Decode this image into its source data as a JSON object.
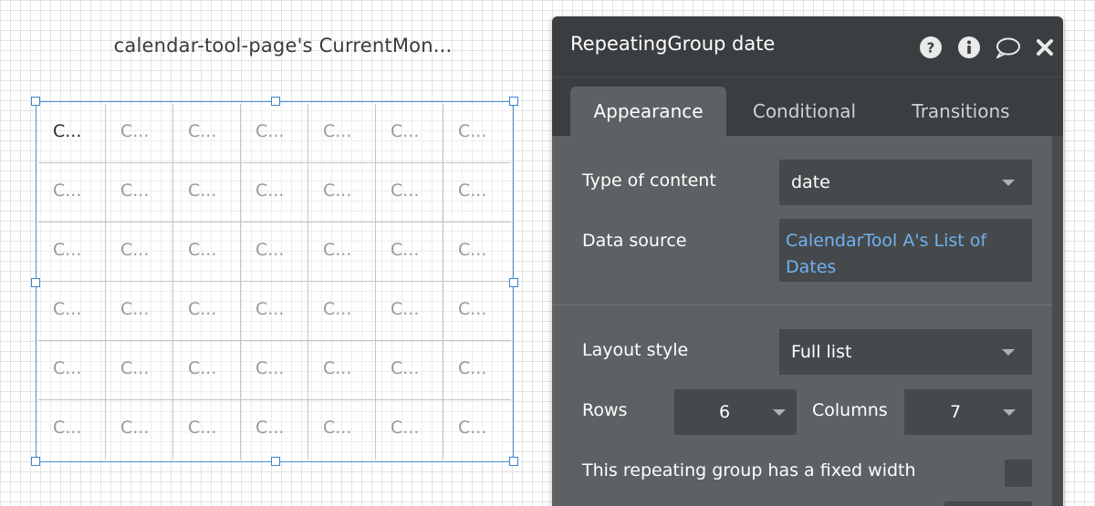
{
  "canvas": {
    "title": "calendar-tool-page's CurrentMon...",
    "cells": [
      "C...",
      "C...",
      "C...",
      "C...",
      "C...",
      "C...",
      "C...",
      "C...",
      "C...",
      "C...",
      "C...",
      "C...",
      "C...",
      "C...",
      "C...",
      "C...",
      "C...",
      "C...",
      "C...",
      "C...",
      "C...",
      "C...",
      "C...",
      "C...",
      "C...",
      "C...",
      "C...",
      "C...",
      "C...",
      "C...",
      "C...",
      "C...",
      "C...",
      "C...",
      "C...",
      "C...",
      "C...",
      "C...",
      "C...",
      "C...",
      "C...",
      "C..."
    ]
  },
  "panel": {
    "title": "RepeatingGroup date",
    "icons": [
      "help-icon",
      "info-icon",
      "comment-icon",
      "close-icon"
    ],
    "tabs": [
      "Appearance",
      "Conditional",
      "Transitions"
    ],
    "active_tab": "Appearance",
    "type_of_content": {
      "label": "Type of content",
      "value": "date"
    },
    "data_source": {
      "label": "Data source",
      "value": "CalendarTool A's List of Dates"
    },
    "layout_style": {
      "label": "Layout style",
      "value": "Full list"
    },
    "rows": {
      "label": "Rows",
      "value": "6"
    },
    "columns": {
      "label": "Columns",
      "value": "7"
    },
    "fixed_width": {
      "label": "This repeating group has a fixed width"
    }
  },
  "colors": {
    "selection": "#4a8fd6",
    "panel_bg": "#5d6163",
    "panel_header": "#3b3e40",
    "field_bg": "#46494b",
    "link": "#6fb1f2"
  }
}
